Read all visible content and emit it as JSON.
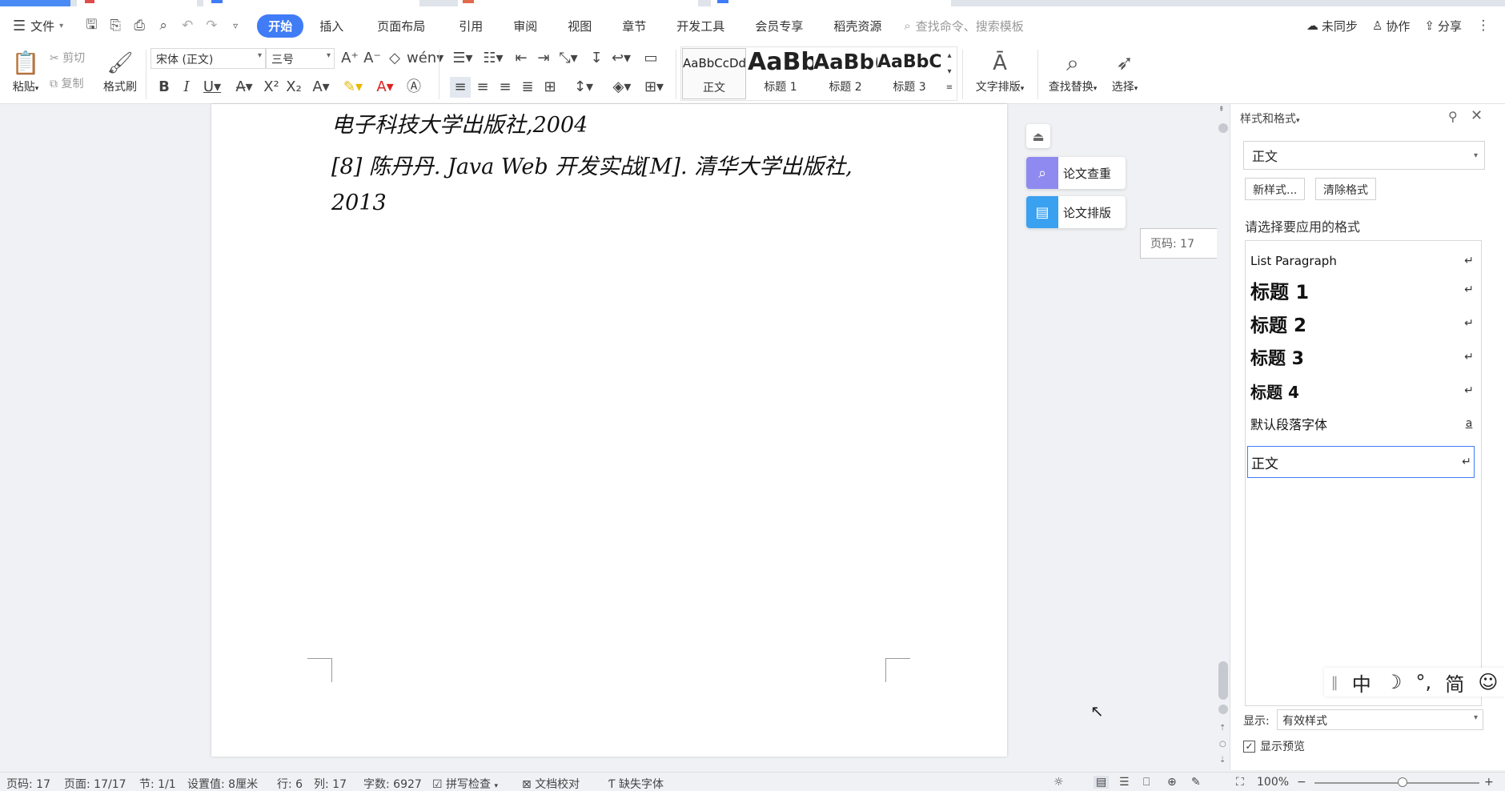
{
  "menubar": {
    "file_label": "文件",
    "tabs": [
      {
        "label": "开始",
        "active": true
      },
      {
        "label": "插入"
      },
      {
        "label": "页面布局"
      },
      {
        "label": "引用"
      },
      {
        "label": "审阅"
      },
      {
        "label": "视图"
      },
      {
        "label": "章节"
      },
      {
        "label": "开发工具"
      },
      {
        "label": "会员专享"
      },
      {
        "label": "稻壳资源"
      }
    ],
    "search_placeholder": "查找命令、搜索模板",
    "sync_label": "未同步",
    "collab_label": "协作",
    "share_label": "分享"
  },
  "ribbon": {
    "paste_label": "粘贴",
    "cut_label": "剪切",
    "copy_label": "复制",
    "format_painter_label": "格式刷",
    "font_name": "宋体 (正文)",
    "font_size": "三号",
    "styles": [
      {
        "preview": "AaBbCcDd",
        "name": "正文"
      },
      {
        "preview": "AaBb",
        "name": "标题 1"
      },
      {
        "preview": "AaBb(",
        "name": "标题 2"
      },
      {
        "preview": "AaBbC",
        "name": "标题 3"
      }
    ],
    "text_layout_label": "文字排版",
    "find_replace_label": "查找替换",
    "select_label": "选择"
  },
  "document": {
    "lines": [
      "电子科技大学出版社,2004",
      "[8]  陈丹丹. Java Web 开发实战[M]. 清华大学出版社,",
      "2013"
    ]
  },
  "side_tools": {
    "check_label": "论文查重",
    "layout_label": "论文排版",
    "page_tip": "页码: 17"
  },
  "pane": {
    "title": "样式和格式",
    "current_style": "正文",
    "new_style_label": "新样式...",
    "clear_format_label": "清除格式",
    "apply_heading": "请选择要应用的格式",
    "styles": [
      {
        "label": "List Paragraph",
        "mark": "↵"
      },
      {
        "label": "标题  1",
        "mark": "↵"
      },
      {
        "label": "标题  2",
        "mark": "↵"
      },
      {
        "label": "标题  3",
        "mark": "↵"
      },
      {
        "label": "标题  4",
        "mark": "↵"
      },
      {
        "label": "默认段落字体",
        "mark": "a"
      },
      {
        "label": "正文",
        "mark": "↵"
      }
    ],
    "show_label": "显示:",
    "show_value": "有效样式",
    "preview_label": "显示预览"
  },
  "ime": {
    "items": [
      "中",
      "☽",
      "°,",
      "简",
      "☺"
    ]
  },
  "status": {
    "page": "页码: 17",
    "pages": "页面: 17/17",
    "section": "节: 1/1",
    "setting": "设置值: 8厘米",
    "row": "行: 6",
    "col": "列: 17",
    "words": "字数: 6927",
    "spell": "拼写检查",
    "proof": "文档校对",
    "missing_font": "缺失字体",
    "zoom": "100%"
  }
}
